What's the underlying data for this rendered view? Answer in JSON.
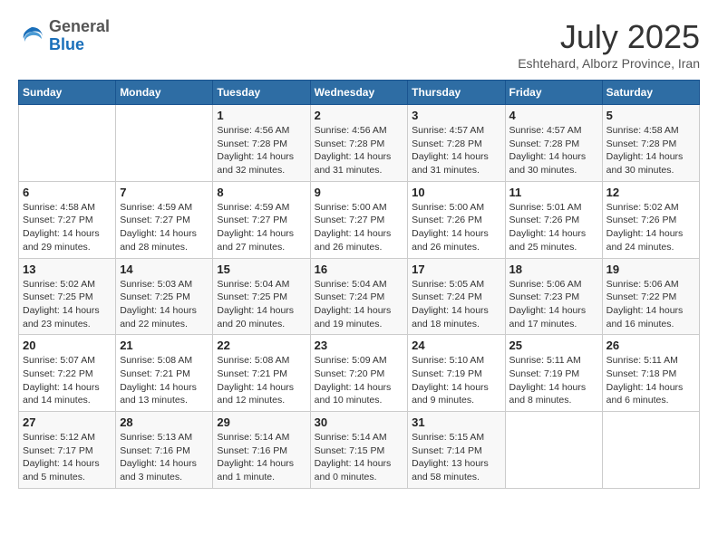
{
  "header": {
    "logo": {
      "general": "General",
      "blue": "Blue"
    },
    "title": "July 2025",
    "location": "Eshtehard, Alborz Province, Iran"
  },
  "calendar": {
    "weekdays": [
      "Sunday",
      "Monday",
      "Tuesday",
      "Wednesday",
      "Thursday",
      "Friday",
      "Saturday"
    ],
    "weeks": [
      [
        {
          "day": "",
          "info": ""
        },
        {
          "day": "",
          "info": ""
        },
        {
          "day": "1",
          "info": "Sunrise: 4:56 AM\nSunset: 7:28 PM\nDaylight: 14 hours\nand 32 minutes."
        },
        {
          "day": "2",
          "info": "Sunrise: 4:56 AM\nSunset: 7:28 PM\nDaylight: 14 hours\nand 31 minutes."
        },
        {
          "day": "3",
          "info": "Sunrise: 4:57 AM\nSunset: 7:28 PM\nDaylight: 14 hours\nand 31 minutes."
        },
        {
          "day": "4",
          "info": "Sunrise: 4:57 AM\nSunset: 7:28 PM\nDaylight: 14 hours\nand 30 minutes."
        },
        {
          "day": "5",
          "info": "Sunrise: 4:58 AM\nSunset: 7:28 PM\nDaylight: 14 hours\nand 30 minutes."
        }
      ],
      [
        {
          "day": "6",
          "info": "Sunrise: 4:58 AM\nSunset: 7:27 PM\nDaylight: 14 hours\nand 29 minutes."
        },
        {
          "day": "7",
          "info": "Sunrise: 4:59 AM\nSunset: 7:27 PM\nDaylight: 14 hours\nand 28 minutes."
        },
        {
          "day": "8",
          "info": "Sunrise: 4:59 AM\nSunset: 7:27 PM\nDaylight: 14 hours\nand 27 minutes."
        },
        {
          "day": "9",
          "info": "Sunrise: 5:00 AM\nSunset: 7:27 PM\nDaylight: 14 hours\nand 26 minutes."
        },
        {
          "day": "10",
          "info": "Sunrise: 5:00 AM\nSunset: 7:26 PM\nDaylight: 14 hours\nand 26 minutes."
        },
        {
          "day": "11",
          "info": "Sunrise: 5:01 AM\nSunset: 7:26 PM\nDaylight: 14 hours\nand 25 minutes."
        },
        {
          "day": "12",
          "info": "Sunrise: 5:02 AM\nSunset: 7:26 PM\nDaylight: 14 hours\nand 24 minutes."
        }
      ],
      [
        {
          "day": "13",
          "info": "Sunrise: 5:02 AM\nSunset: 7:25 PM\nDaylight: 14 hours\nand 23 minutes."
        },
        {
          "day": "14",
          "info": "Sunrise: 5:03 AM\nSunset: 7:25 PM\nDaylight: 14 hours\nand 22 minutes."
        },
        {
          "day": "15",
          "info": "Sunrise: 5:04 AM\nSunset: 7:25 PM\nDaylight: 14 hours\nand 20 minutes."
        },
        {
          "day": "16",
          "info": "Sunrise: 5:04 AM\nSunset: 7:24 PM\nDaylight: 14 hours\nand 19 minutes."
        },
        {
          "day": "17",
          "info": "Sunrise: 5:05 AM\nSunset: 7:24 PM\nDaylight: 14 hours\nand 18 minutes."
        },
        {
          "day": "18",
          "info": "Sunrise: 5:06 AM\nSunset: 7:23 PM\nDaylight: 14 hours\nand 17 minutes."
        },
        {
          "day": "19",
          "info": "Sunrise: 5:06 AM\nSunset: 7:22 PM\nDaylight: 14 hours\nand 16 minutes."
        }
      ],
      [
        {
          "day": "20",
          "info": "Sunrise: 5:07 AM\nSunset: 7:22 PM\nDaylight: 14 hours\nand 14 minutes."
        },
        {
          "day": "21",
          "info": "Sunrise: 5:08 AM\nSunset: 7:21 PM\nDaylight: 14 hours\nand 13 minutes."
        },
        {
          "day": "22",
          "info": "Sunrise: 5:08 AM\nSunset: 7:21 PM\nDaylight: 14 hours\nand 12 minutes."
        },
        {
          "day": "23",
          "info": "Sunrise: 5:09 AM\nSunset: 7:20 PM\nDaylight: 14 hours\nand 10 minutes."
        },
        {
          "day": "24",
          "info": "Sunrise: 5:10 AM\nSunset: 7:19 PM\nDaylight: 14 hours\nand 9 minutes."
        },
        {
          "day": "25",
          "info": "Sunrise: 5:11 AM\nSunset: 7:19 PM\nDaylight: 14 hours\nand 8 minutes."
        },
        {
          "day": "26",
          "info": "Sunrise: 5:11 AM\nSunset: 7:18 PM\nDaylight: 14 hours\nand 6 minutes."
        }
      ],
      [
        {
          "day": "27",
          "info": "Sunrise: 5:12 AM\nSunset: 7:17 PM\nDaylight: 14 hours\nand 5 minutes."
        },
        {
          "day": "28",
          "info": "Sunrise: 5:13 AM\nSunset: 7:16 PM\nDaylight: 14 hours\nand 3 minutes."
        },
        {
          "day": "29",
          "info": "Sunrise: 5:14 AM\nSunset: 7:16 PM\nDaylight: 14 hours\nand 1 minute."
        },
        {
          "day": "30",
          "info": "Sunrise: 5:14 AM\nSunset: 7:15 PM\nDaylight: 14 hours\nand 0 minutes."
        },
        {
          "day": "31",
          "info": "Sunrise: 5:15 AM\nSunset: 7:14 PM\nDaylight: 13 hours\nand 58 minutes."
        },
        {
          "day": "",
          "info": ""
        },
        {
          "day": "",
          "info": ""
        }
      ]
    ]
  }
}
